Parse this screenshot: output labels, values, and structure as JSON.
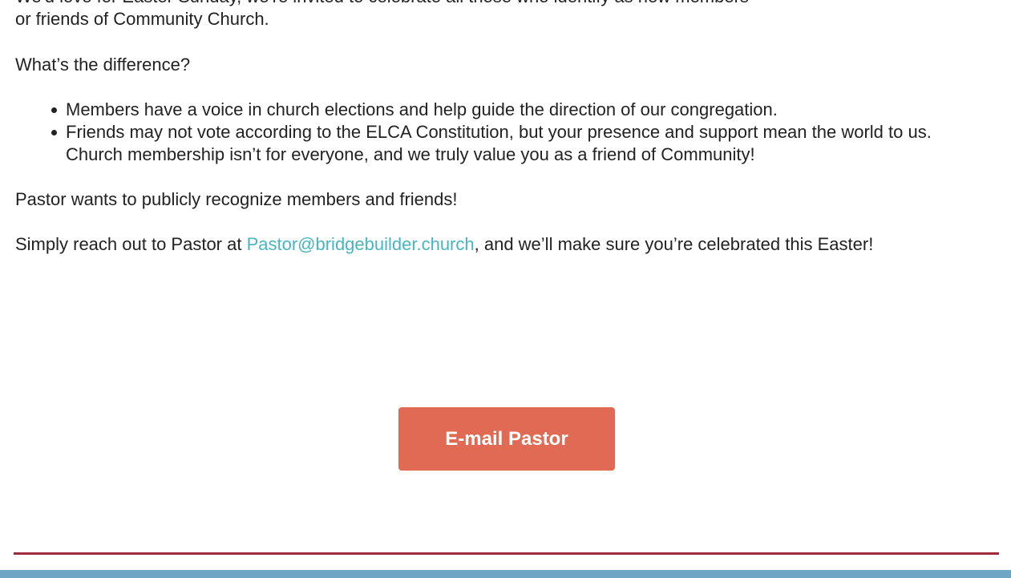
{
  "message": {
    "intro_partial": "We'd love for Easter Sunday, we're invited to celebrate all those who identify as new members",
    "intro_end": "or friends of Community Church.",
    "question": "What’s the difference?",
    "list": [
      {
        "text": "Members have a voice in church elections and help guide the direction of our congregation."
      },
      {
        "text": "Friends may not vote according to the ELCA Constitution, but your presence and support mean the world to us. Church membership isn’t for everyone, and we truly value you as a friend of Community!"
      }
    ],
    "recognize": "Pastor wants to publicly recognize members and friends!",
    "reach_prefix": "Simply reach out to Pastor at ",
    "email": "Pastor@bridgebuilder.church",
    "reach_suffix": ", and we’ll make sure you’re celebrated this Easter!"
  },
  "cta": {
    "label": "E-mail Pastor"
  },
  "colors": {
    "link": "#47b5c2",
    "button": "#e16a54",
    "divider": "#9e2b37",
    "footer": "#6fa6c3"
  }
}
